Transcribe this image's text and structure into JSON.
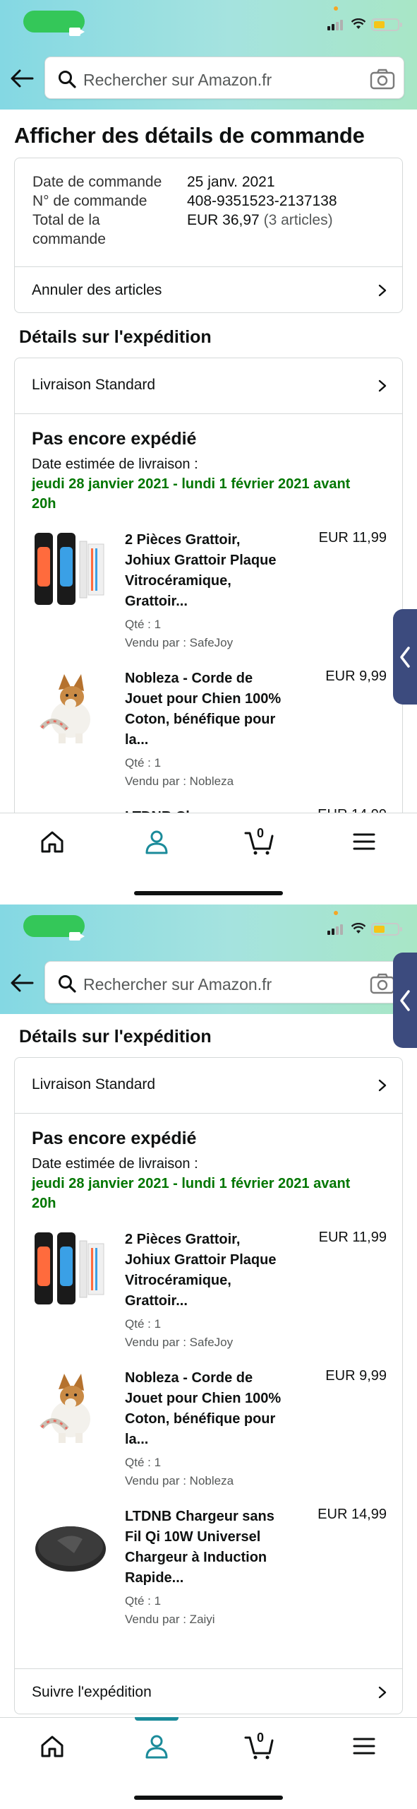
{
  "search": {
    "placeholder": "Rechercher sur Amazon.fr"
  },
  "page_title": "Afficher des détails de commande",
  "order": {
    "date_label": "Date de commande",
    "date_value": "25 janv. 2021",
    "number_label": "N° de commande",
    "number_value": "408-9351523-2137138",
    "total_label_line1": "Total de la",
    "total_label_line2": "commande",
    "total_value": "EUR 36,97",
    "total_count": "(3 articles)",
    "cancel_label": "Annuler des articles"
  },
  "shipment": {
    "section_title": "Détails sur l'expédition",
    "method": "Livraison Standard",
    "status": "Pas encore expédié",
    "estimated_label": "Date estimée de livraison :",
    "estimated_line1": "jeudi 28 janvier 2021 - lundi 1 février 2021 avant",
    "estimated_line2": "20h",
    "track_label": "Suivre l'expédition",
    "items": [
      {
        "name_lines": [
          "2 Pièces Grattoir,",
          "Johiux Grattoir Plaque",
          "Vitrocéramique,",
          "Grattoir..."
        ],
        "price": "EUR 11,99",
        "qty": "Qté : 1",
        "seller": "Vendu par : SafeJoy",
        "icon": "scraper-product-image"
      },
      {
        "name_lines": [
          "Nobleza - Corde de",
          "Jouet pour Chien 100%",
          "Coton, bénéfique pour",
          "la..."
        ],
        "price": "EUR 9,99",
        "qty": "Qté : 1",
        "seller": "Vendu par : Nobleza",
        "icon": "dog-rope-toy-product-image"
      },
      {
        "name_lines": [
          "LTDNB Chargeur sans",
          "Fil Qi 10W Universel",
          "Chargeur à Induction",
          "Rapide..."
        ],
        "price": "EUR 14,99",
        "qty": "Qté : 1",
        "seller": "Vendu par : Zaiyi",
        "icon": "wireless-charger-product-image"
      }
    ]
  },
  "tabbar": {
    "cart_count": "0",
    "active_tab": "account"
  },
  "colors": {
    "delivery_green": "#007600",
    "tab_accent": "#1b8b9a",
    "side_tab": "#3c4b7e",
    "status_pill": "#34c759"
  }
}
